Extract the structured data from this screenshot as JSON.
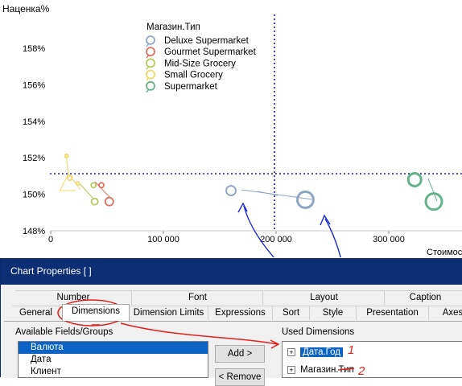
{
  "chart": {
    "ylabel": "Наценка%",
    "xlabel_partial": "Стоимос",
    "legend_title": "Магазин.Тип",
    "legend": [
      {
        "name": "Deluxe Supermarket",
        "color": "#8ea5c4"
      },
      {
        "name": "Gourmet Supermarket",
        "color": "#e07060"
      },
      {
        "name": "Mid-Size Grocery",
        "color": "#b5cc5a"
      },
      {
        "name": "Small Grocery",
        "color": "#f0d86a"
      },
      {
        "name": "Supermarket",
        "color": "#64b28a"
      }
    ],
    "yticks": [
      "158%",
      "156%",
      "154%",
      "152%",
      "150%",
      "148%"
    ],
    "xticks": [
      "0",
      "100 000",
      "200 000",
      "300 000"
    ]
  },
  "chart_data": {
    "type": "scatter",
    "ylabel": "Наценка%",
    "xlabel": "Стоимос",
    "ylim": [
      148,
      159
    ],
    "xlim": [
      0,
      360000
    ],
    "reference_lines": {
      "x": 190000,
      "y": 151
    },
    "series": [
      {
        "name": "Deluxe Supermarket",
        "color": "#8ea5c4",
        "points": [
          [
            160000,
            150.2,
            6
          ],
          [
            226000,
            149.7,
            10
          ]
        ]
      },
      {
        "name": "Gourmet Supermarket",
        "color": "#e07060",
        "points": [
          [
            45000,
            150.5,
            3
          ],
          [
            52000,
            149.6,
            5
          ]
        ]
      },
      {
        "name": "Mid-Size Grocery",
        "color": "#b5cc5a",
        "points": [
          [
            38000,
            150.5,
            3
          ],
          [
            39000,
            149.6,
            4
          ]
        ]
      },
      {
        "name": "Small Grocery",
        "color": "#f0d86a",
        "points": [
          [
            14000,
            152.1,
            2
          ],
          [
            17000,
            150.9,
            3
          ],
          [
            24000,
            150.6,
            2
          ]
        ]
      },
      {
        "name": "Supermarket",
        "color": "#64b28a",
        "points": [
          [
            323000,
            150.8,
            8
          ],
          [
            340000,
            149.6,
            10
          ]
        ]
      }
    ],
    "grid": false,
    "legend_position": "top-left"
  },
  "annotations": {
    "mark1": "1",
    "mark2": "2"
  },
  "dialog": {
    "title": "Chart Properties [ ]",
    "tabs_row1": [
      "Number",
      "Font",
      "Layout",
      "Caption"
    ],
    "tabs_row2": [
      "General",
      "Dimensions",
      "Dimension Limits",
      "Expressions",
      "Sort",
      "Style",
      "Presentation",
      "Axes"
    ],
    "available_label": "Available Fields/Groups",
    "available_items": [
      "Валюта",
      "Дата",
      "Клиент"
    ],
    "add_button": "Add >",
    "remove_button": "< Remove",
    "used_label": "Used Dimensions",
    "used_items": [
      "Дата.Год",
      "Магазин.Тип"
    ]
  }
}
